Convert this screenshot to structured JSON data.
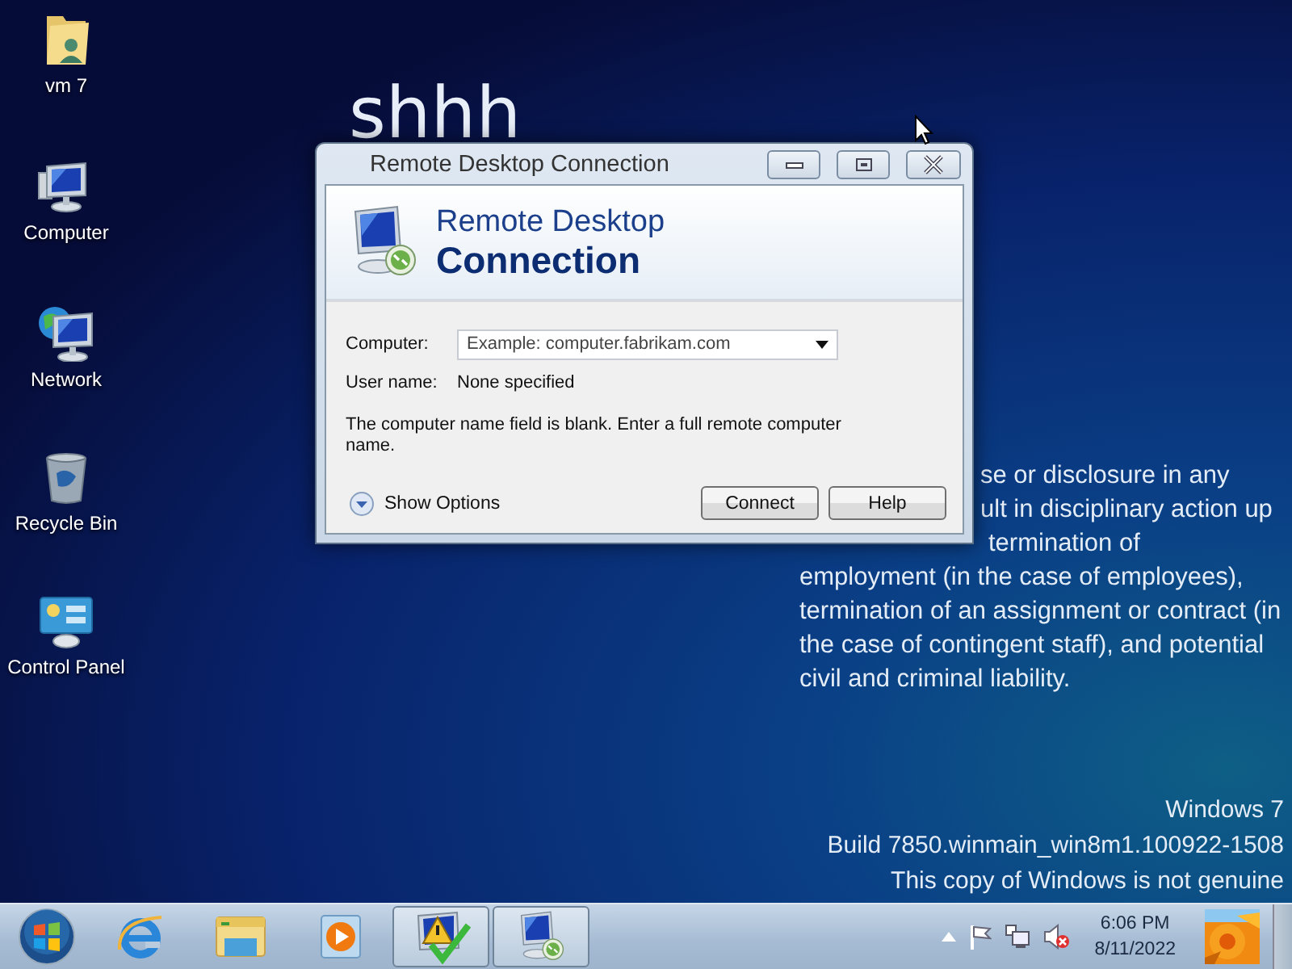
{
  "desktop": {
    "icons": [
      {
        "kind": "folder",
        "label": "vm 7"
      },
      {
        "kind": "computer",
        "label": "Computer"
      },
      {
        "kind": "network",
        "label": "Network"
      },
      {
        "kind": "bin",
        "label": "Recycle Bin"
      },
      {
        "kind": "control",
        "label": "Control Panel"
      }
    ],
    "banner": "shhh",
    "notice_lines": [
      "se or disclosure in any",
      "ult in disciplinary action up",
      "termination of",
      "employment (in the case of employees),",
      "termination of an assignment or contract (in",
      "the case of contingent staff), and potential",
      "civil and criminal liability."
    ],
    "watermark": [
      "Windows 7",
      "Build 7850.winmain_win8m1.100922-1508",
      "This copy of Windows is not genuine"
    ]
  },
  "dialog": {
    "title": "Remote Desktop Connection",
    "heading_line1": "Remote Desktop",
    "heading_line2": "Connection",
    "computer_label": "Computer:",
    "computer_placeholder": "Example: computer.fabrikam.com",
    "user_label": "User name:",
    "user_value": "None specified",
    "message": "The computer name field is blank. Enter a full remote computer name.",
    "show_options": "Show Options",
    "buttons": [
      "Connect",
      "Help"
    ]
  },
  "taskbar": {
    "items": [
      {
        "kind": "browser",
        "running": false
      },
      {
        "kind": "explorer",
        "running": false
      },
      {
        "kind": "media",
        "running": false
      },
      {
        "kind": "action",
        "running": true
      },
      {
        "kind": "rdc",
        "running": true
      }
    ],
    "time": "6:06 PM",
    "date": "8/11/2022"
  }
}
